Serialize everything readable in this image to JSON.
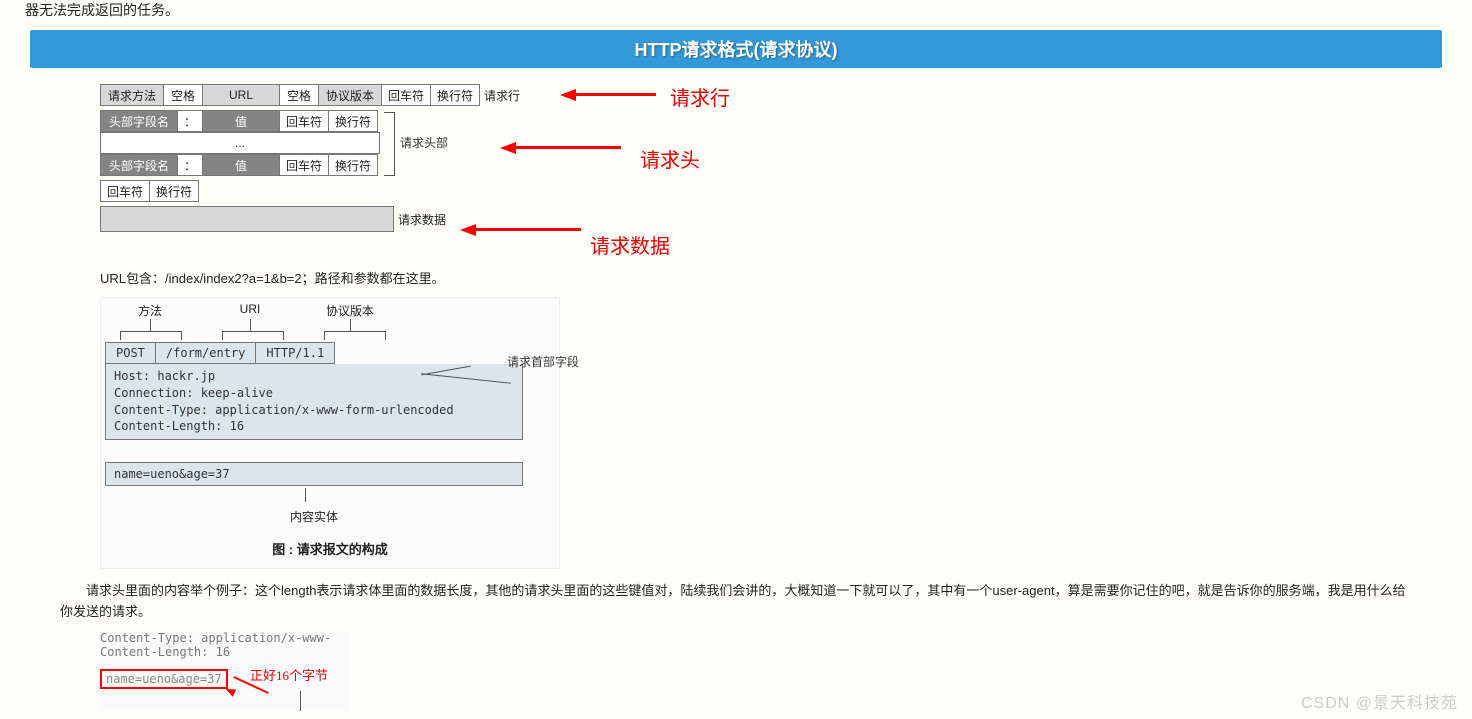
{
  "top_cut": "器无法完成返回的任务。",
  "banner": "HTTP请求格式(请求协议)",
  "diagram": {
    "row1": [
      "请求方法",
      "空格",
      "URL",
      "空格",
      "协议版本",
      "回车符",
      "换行符"
    ],
    "row1_label": "请求行",
    "row2": [
      "头部字段名",
      "：",
      "值",
      "回车符",
      "换行符"
    ],
    "row3": "...",
    "row4": [
      "头部字段名",
      "：",
      "值",
      "回车符",
      "换行符"
    ],
    "row2_label": "请求头部",
    "row5": [
      "回车符",
      "换行符"
    ],
    "row6_label": "请求数据",
    "red_labels": {
      "a": "请求行",
      "b": "请求头",
      "c": "请求数据"
    }
  },
  "para_url": "URL包含：/index/index2?a=1&b=2；路径和参数都在这里。",
  "fig2": {
    "labels": {
      "method": "方法",
      "uri": "URI",
      "proto": "协议版本",
      "side": "请求首部字段",
      "entity": "内容实体"
    },
    "req": {
      "method": "POST",
      "uri": "/form/entry",
      "proto": "HTTP/1.1"
    },
    "headers": [
      "Host: hackr.jp",
      "Connection: keep-alive",
      "Content-Type: application/x-www-form-urlencoded",
      "Content-Length: 16"
    ],
    "body": "name=ueno&age=37",
    "caption": "图 : 请求报文的构成"
  },
  "para2": "请求头里面的内容举个例子：这个length表示请求体里面的数据长度，其他的请求头里面的这些键值对，陆续我们会讲的，大概知道一下就可以了，其中有一个user-agent，算是需要你记住的吧，就是告诉你的服务端，我是用什么给你发送的请求。",
  "fig3": {
    "line1": "Content-Type: application/x-www-",
    "line2": "Content-Length: 16",
    "note": "正好16个字节",
    "body": "name=ueno&age=37"
  },
  "watermark": "CSDN @景天科技苑"
}
